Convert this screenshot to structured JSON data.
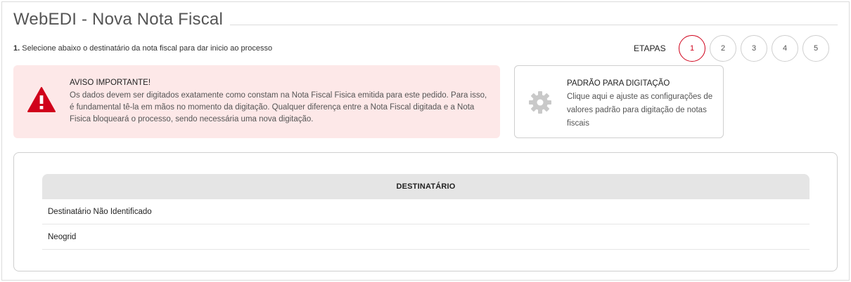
{
  "page": {
    "title": "WebEDI - Nova Nota Fiscal",
    "instruction_number": "1.",
    "instruction_text": " Selecione abaixo o destinatário da nota fiscal para dar inicio ao processo"
  },
  "steps": {
    "label": "ETAPAS",
    "items": [
      "1",
      "2",
      "3",
      "4",
      "5"
    ],
    "active": "1",
    "active_color": "#d0021b"
  },
  "alert": {
    "icon": "warning-icon",
    "title": "AVISO IMPORTANTE!",
    "text": "Os dados devem ser digitados exatamente como constam na Nota Fiscal Fisica emitida para este pedido. Para isso, é fundamental tê-la em mãos no momento da digitação. Qualquer diferença entre a Nota Fiscal digitada e a Nota Fisica bloqueará o processo, sendo necessária uma nova digitação.",
    "background": "#fde8e8",
    "icon_color": "#d0021b"
  },
  "defaults_card": {
    "icon": "gear-icon",
    "title": "PADRÃO PARA DIGITAÇÃO",
    "text": "Clique aqui e ajuste as configurações de valores padrão para digitação de notas fiscais"
  },
  "recipients_table": {
    "header": "DESTINATÁRIO",
    "rows": [
      "Destinatário Não Identificado",
      "Neogrid"
    ]
  }
}
